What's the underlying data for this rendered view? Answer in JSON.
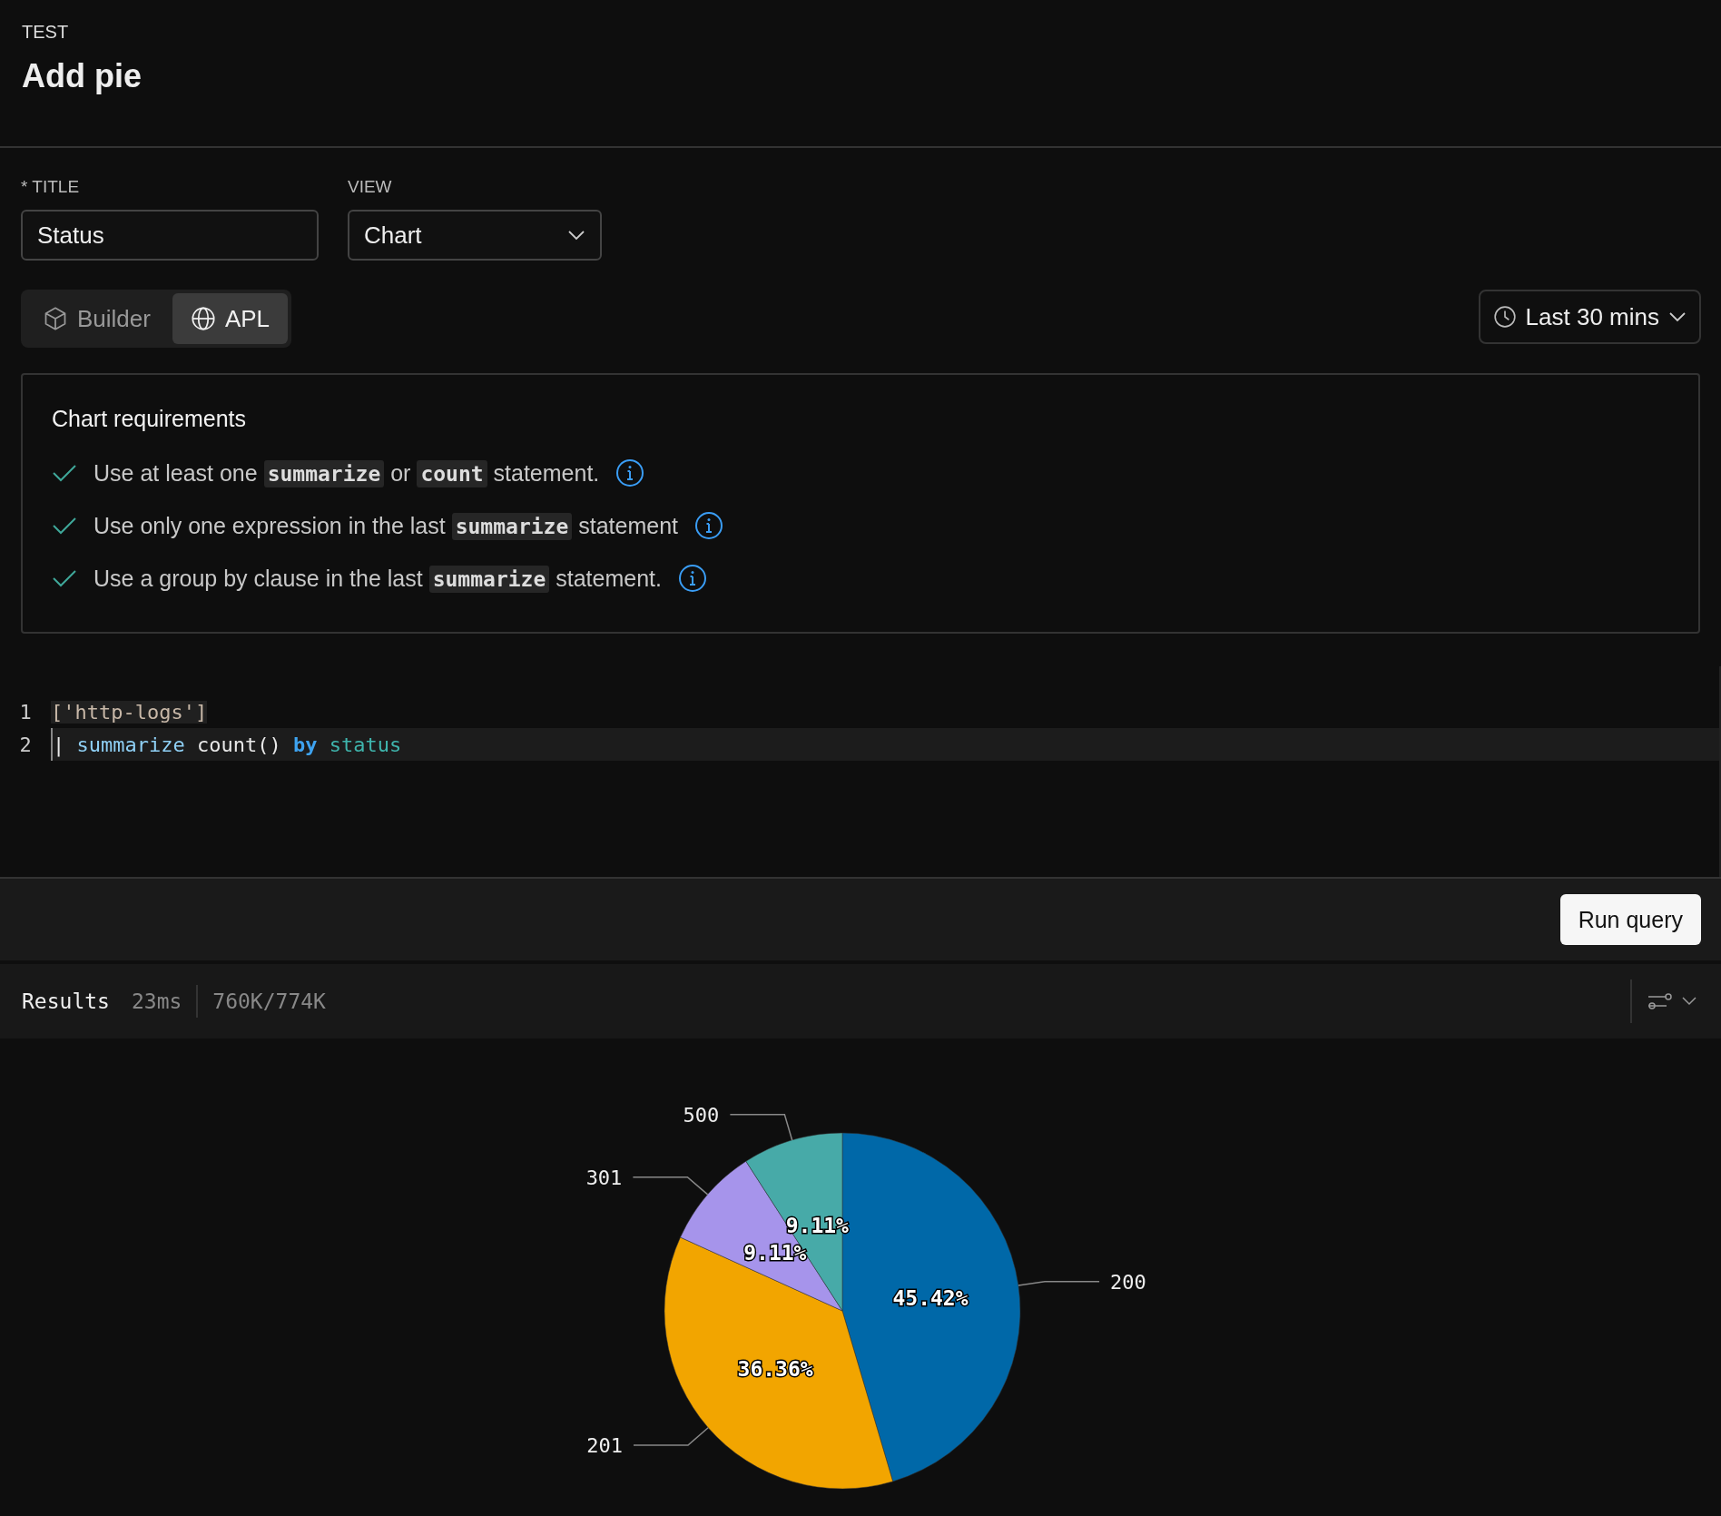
{
  "header": {
    "eyebrow": "TEST",
    "title": "Add pie"
  },
  "form": {
    "title_label": "* TITLE",
    "title_value": "Status",
    "view_label": "VIEW",
    "view_value": "Chart"
  },
  "mode_tabs": [
    {
      "label": "Builder",
      "kind": "cube",
      "selected": false
    },
    {
      "label": "APL",
      "kind": "globe",
      "selected": true
    }
  ],
  "time_range": "Last 30 mins",
  "requirements": {
    "title": "Chart requirements",
    "items": [
      {
        "met": true,
        "parts": [
          {
            "kind": "text",
            "text": "Use at least one "
          },
          {
            "kind": "code",
            "text": "summarize"
          },
          {
            "kind": "text",
            "text": " or "
          },
          {
            "kind": "code",
            "text": "count"
          },
          {
            "kind": "text",
            "text": " statement."
          }
        ]
      },
      {
        "met": true,
        "parts": [
          {
            "kind": "text",
            "text": "Use only one expression in the last "
          },
          {
            "kind": "code",
            "text": "summarize"
          },
          {
            "kind": "text",
            "text": " statement"
          }
        ]
      },
      {
        "met": true,
        "parts": [
          {
            "kind": "text",
            "text": "Use a group by clause in the last "
          },
          {
            "kind": "code",
            "text": "summarize"
          },
          {
            "kind": "text",
            "text": " statement."
          }
        ]
      }
    ]
  },
  "editor": {
    "lines": [
      {
        "number": "1",
        "active": false,
        "tokens": [
          {
            "kind": "string",
            "text": "['http-logs']"
          }
        ]
      },
      {
        "number": "2",
        "active": true,
        "tokens": [
          {
            "kind": "plain",
            "text": "| "
          },
          {
            "kind": "function",
            "text": "summarize"
          },
          {
            "kind": "plain",
            "text": " count() "
          },
          {
            "kind": "keyword",
            "text": "by"
          },
          {
            "kind": "field",
            "text": " status"
          }
        ]
      }
    ]
  },
  "run_button": "Run query",
  "results": {
    "label": "Results",
    "duration": "23ms",
    "count": "760K/774K"
  },
  "chart_data": {
    "type": "pie",
    "categories": [
      "200",
      "201",
      "301",
      "500"
    ],
    "values": [
      45.42,
      36.36,
      9.11,
      9.11
    ],
    "value_labels": [
      "45.42%",
      "36.36%",
      "9.11%",
      "9.11%"
    ]
  }
}
